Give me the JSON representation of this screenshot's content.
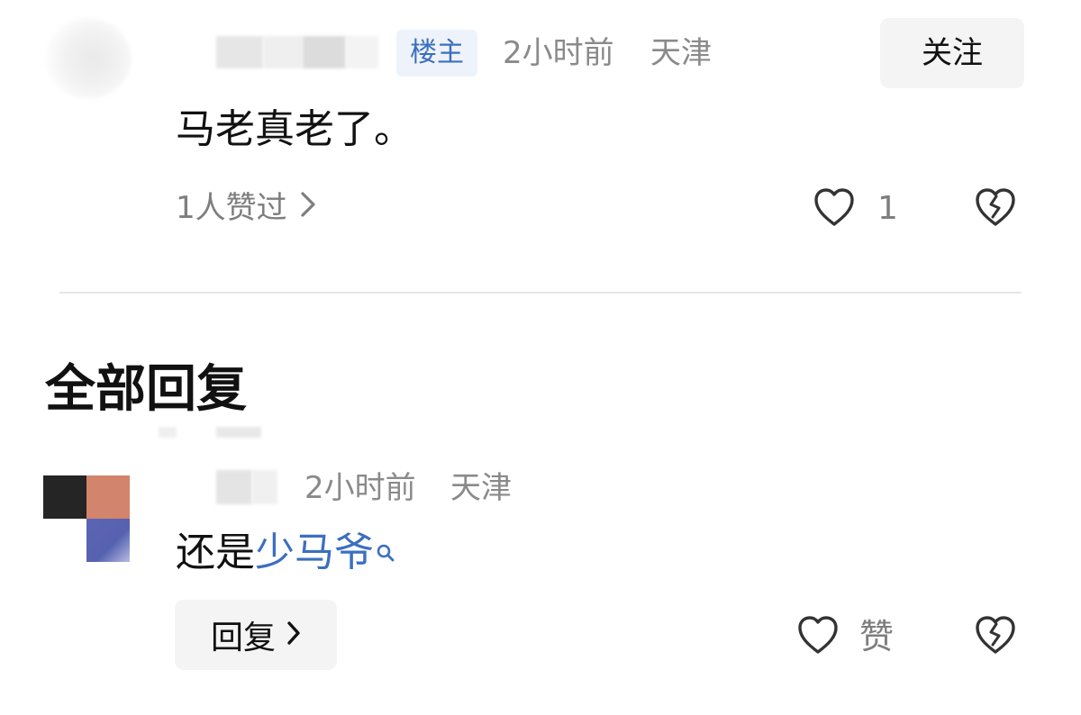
{
  "main_comment": {
    "badge": "楼主",
    "time": "2小时前",
    "location": "天津",
    "follow_label": "关注",
    "text": "马老真老了。",
    "likers_text": "1人赞过",
    "like_count": "1"
  },
  "replies_section": {
    "title": "全部回复"
  },
  "reply": {
    "time": "2小时前",
    "location": "天津",
    "text_prefix": "还是",
    "hashtag": "少马爷",
    "reply_label": "回复",
    "like_label": "赞"
  },
  "colors": {
    "link_blue": "#3b6fc0",
    "meta_gray": "#8a8a8a",
    "button_bg": "#f4f4f4"
  },
  "icons": {
    "like": "heart-outline-icon",
    "dislike": "broken-heart-icon",
    "chevron": "chevron-right-icon",
    "search": "search-icon"
  }
}
